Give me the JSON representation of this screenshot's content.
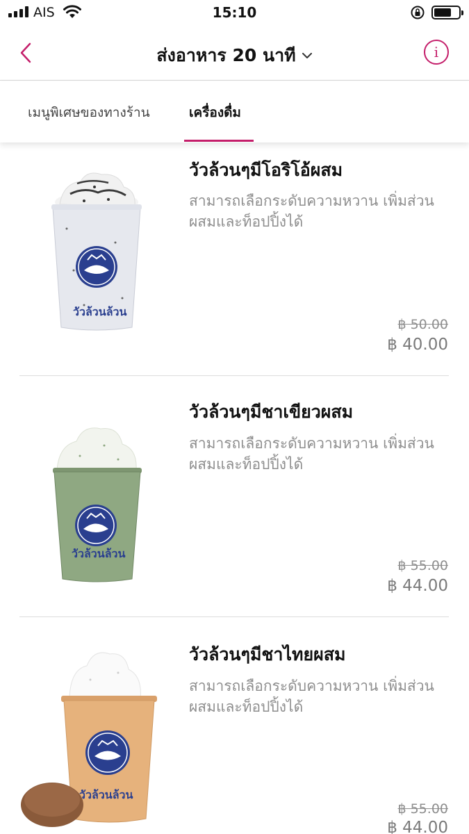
{
  "status_bar": {
    "carrier": "AIS",
    "time": "15:10",
    "battery_level": 0.7
  },
  "header": {
    "title": "ส่งอาหาร 20 นาที"
  },
  "tabs": [
    {
      "label": "เมนูพิเศษของทางร้าน",
      "active": false
    },
    {
      "label": "เครื่องดื่ม",
      "active": true
    }
  ],
  "items": [
    {
      "name": "วัวล้วนๆมีโอริโอ้ผสม",
      "desc": "สามารถเลือกระดับความหวาน เพิ่มส่วนผสมและท็อปปิ้งได้",
      "price_old": "฿ 50.00",
      "price_new": "฿ 40.00",
      "drink_color": "#e6e8ee"
    },
    {
      "name": "วัวล้วนๆมีชาเขียวผสม",
      "desc": "สามารถเลือกระดับความหวาน เพิ่มส่วนผสมและท็อปปิ้งได้",
      "price_old": "฿ 55.00",
      "price_new": "฿ 44.00",
      "drink_color": "#8fa882"
    },
    {
      "name": "วัวล้วนๆมีชาไทยผสม",
      "desc": "สามารถเลือกระดับความหวาน เพิ่มส่วนผสมและท็อปปิ้งได้",
      "price_old": "฿ 55.00",
      "price_new": "฿ 44.00",
      "drink_color": "#e6b27c"
    }
  ],
  "brand": {
    "logo_text": "วัวล้วนล้วน"
  },
  "colors": {
    "accent": "#c41e6a",
    "logo_blue": "#2a3f8f"
  }
}
